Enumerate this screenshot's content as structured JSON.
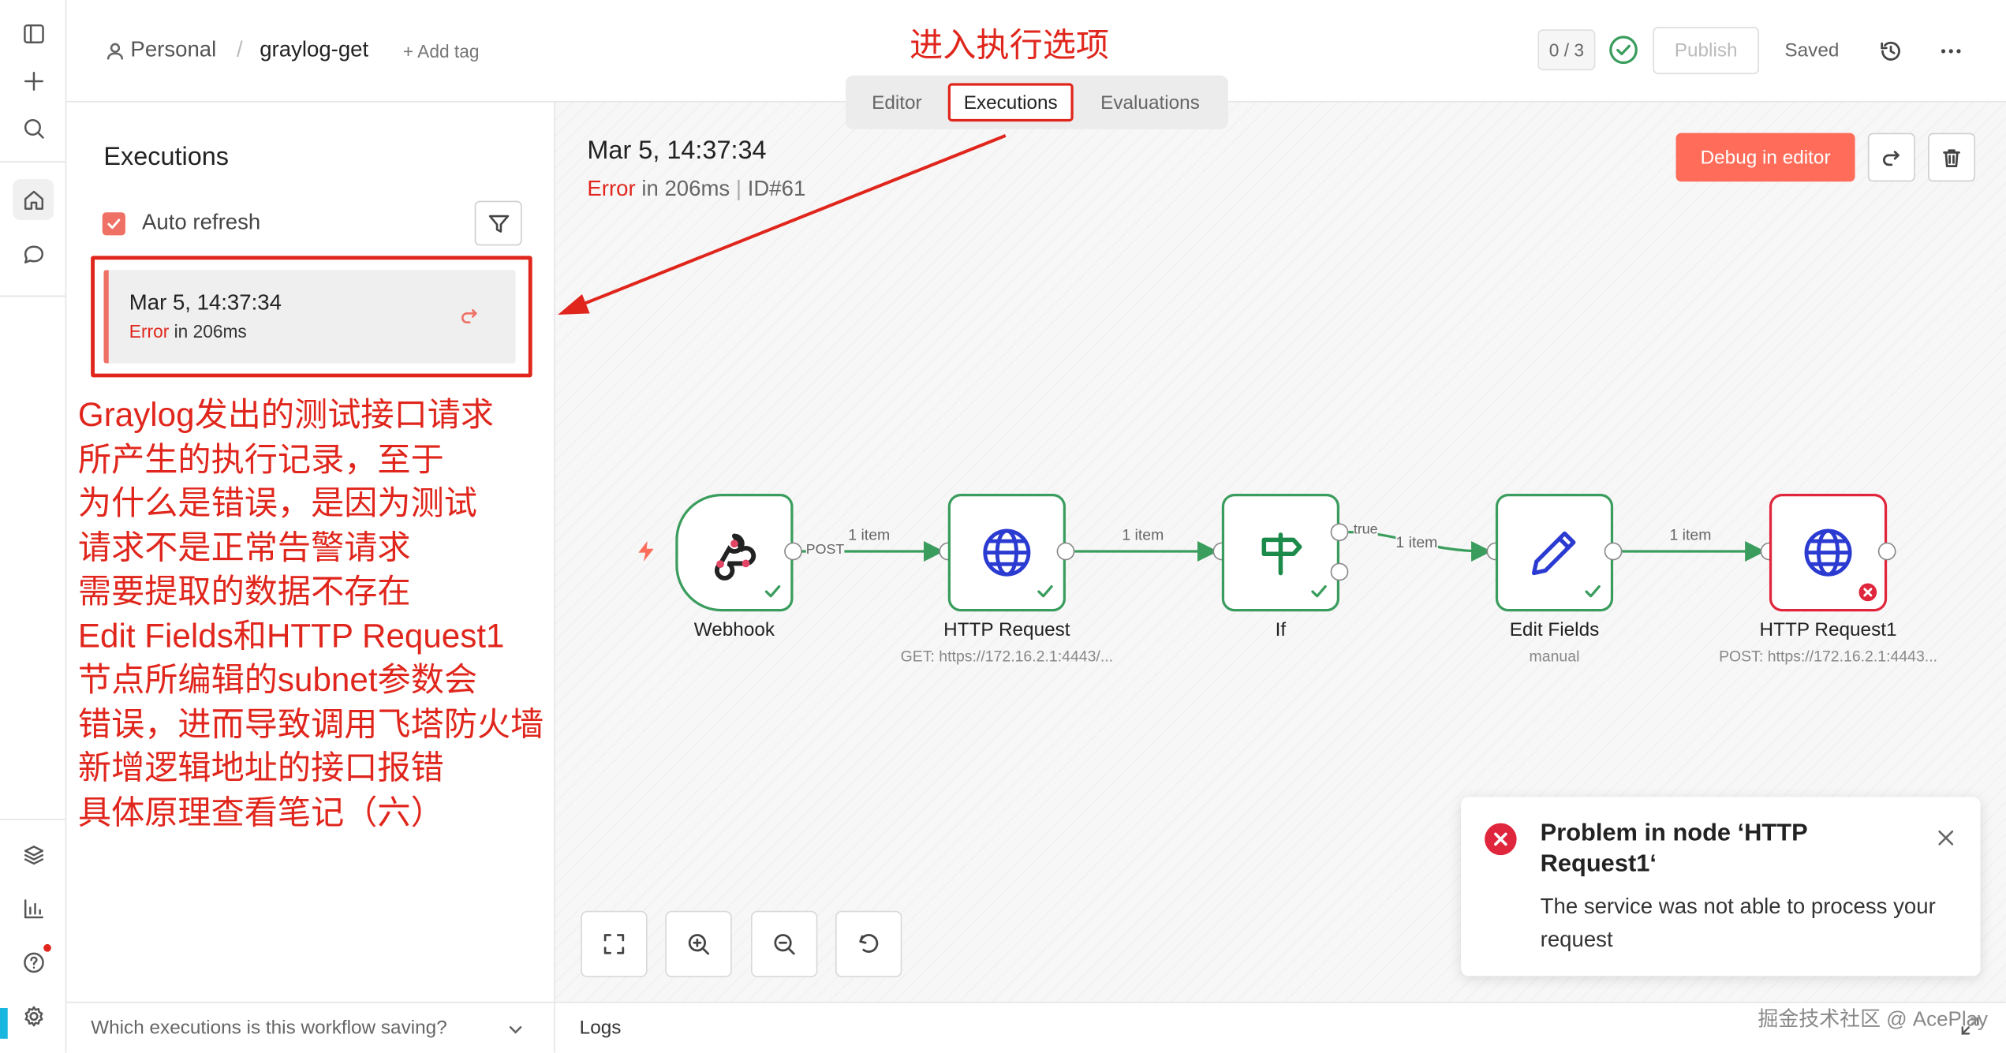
{
  "colors": {
    "accent": "#ff6d5a",
    "success": "#3a9d5d",
    "error": "#e0261c",
    "annotation": "#e0261c"
  },
  "header": {
    "user_icon": "user-icon",
    "breadcrumb_project": "Personal",
    "breadcrumb_separator": "/",
    "workflow_name": "graylog-get",
    "add_tag": "+ Add tag",
    "counter": "0 / 3",
    "publish_label": "Publish",
    "saved_label": "Saved"
  },
  "tabs": [
    {
      "label": "Editor"
    },
    {
      "label": "Executions"
    },
    {
      "label": "Evaluations"
    }
  ],
  "sidebar": {
    "title": "Executions",
    "auto_refresh_label": "Auto refresh",
    "auto_refresh_checked": true,
    "executions": [
      {
        "time": "Mar 5, 14:37:34",
        "status": "Error",
        "duration": " in 206ms"
      }
    ],
    "footer_question": "Which executions is this workflow saving?"
  },
  "execution": {
    "time": "Mar 5, 14:37:34",
    "status": "Error",
    "duration": " in 206ms",
    "separator": "|",
    "id": "ID#61",
    "debug_button": "Debug in editor"
  },
  "workflow": {
    "nodes": [
      {
        "name": "Webhook",
        "subtitle": "",
        "icon": "webhook-icon",
        "state": "success"
      },
      {
        "name": "HTTP Request",
        "subtitle": "GET: https://172.16.2.1:4443/...",
        "icon": "globe-icon",
        "state": "success"
      },
      {
        "name": "If",
        "subtitle": "",
        "icon": "signpost-icon",
        "state": "success"
      },
      {
        "name": "Edit Fields",
        "subtitle": "manual",
        "icon": "pencil-icon",
        "state": "success"
      },
      {
        "name": "HTTP Request1",
        "subtitle": "POST: https://172.16.2.1:4443...",
        "icon": "globe-icon",
        "state": "error"
      }
    ],
    "edges": [
      {
        "label": "1 item",
        "port_label": "POST"
      },
      {
        "label": "1 item",
        "port_label": ""
      },
      {
        "label": "1 item",
        "port_label": "true"
      },
      {
        "label": "1 item",
        "port_label": ""
      }
    ]
  },
  "toast": {
    "title": "Problem in node ‘HTTP Request1‘",
    "message": "The service was not able to process your request"
  },
  "logs": {
    "label": "Logs"
  },
  "annotations": {
    "tab_hint": "进入执行选项",
    "note": "Graylog发出的测试接口请求\n所产生的执行记录，至于\n为什么是错误，是因为测试\n请求不是正常告警请求\n需要提取的数据不存在\nEdit Fields和HTTP Request1\n节点所编辑的subnet参数会\n错误，进而导致调用飞塔防火墙\n新增逻辑地址的接口报错\n具体原理查看笔记（六）"
  },
  "watermark": "掘金技术社区 @ AcePlay"
}
